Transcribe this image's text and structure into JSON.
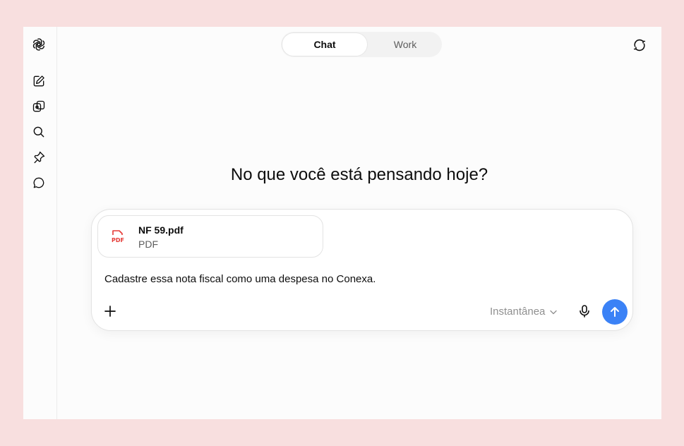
{
  "sidebar": {
    "items": [
      {
        "icon": "openai-logo-icon"
      },
      {
        "icon": "new-chat-icon"
      },
      {
        "icon": "library-icon"
      },
      {
        "icon": "search-icon"
      },
      {
        "icon": "pin-icon"
      },
      {
        "icon": "chat-bubble-icon"
      }
    ]
  },
  "header": {
    "tabs": [
      {
        "label": "Chat",
        "active": true
      },
      {
        "label": "Work",
        "active": false
      }
    ],
    "right_icon": "refresh-chat-icon"
  },
  "main": {
    "heading": "No que você está pensando hoje?"
  },
  "composer": {
    "attachment": {
      "name": "NF 59.pdf",
      "type": "PDF",
      "icon_label": "PDF",
      "icon_color": "#e53935"
    },
    "text": "Cadastre essa nota fiscal como uma despesa no Conexa.",
    "model": "Instantânea",
    "send_color": "#3b82f6"
  }
}
